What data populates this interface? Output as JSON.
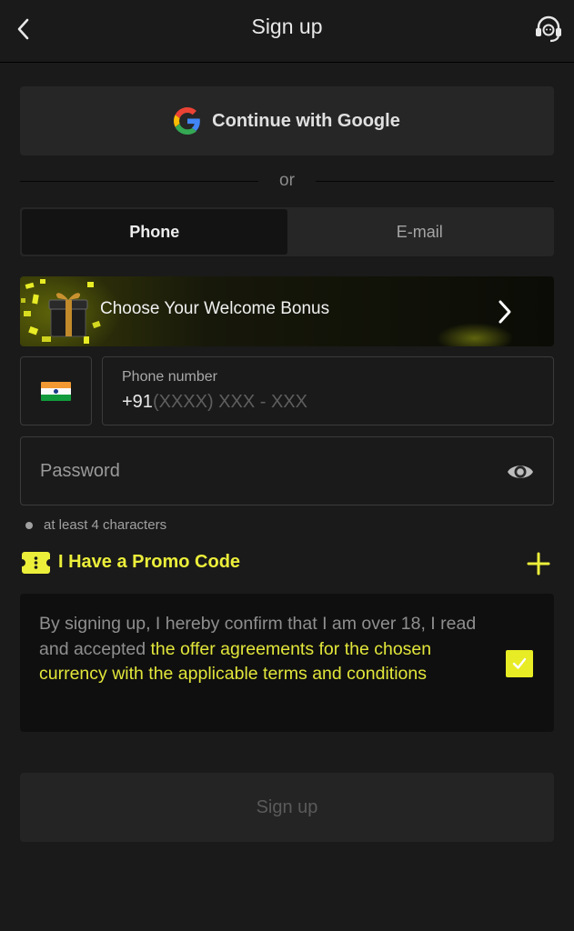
{
  "header": {
    "title": "Sign up"
  },
  "google": {
    "label": "Continue with Google"
  },
  "divider": {
    "text": "or"
  },
  "tabs": [
    {
      "label": "Phone",
      "active": true
    },
    {
      "label": "E-mail",
      "active": false
    }
  ],
  "bonus": {
    "label": "Choose Your Welcome Bonus"
  },
  "phone": {
    "label": "Phone number",
    "prefix": "+91",
    "placeholder": "(XXXX) XXX - XXX"
  },
  "password": {
    "placeholder": "Password"
  },
  "hint": {
    "text": "at least 4 characters"
  },
  "promo": {
    "label": "I Have a Promo Code"
  },
  "terms": {
    "text_plain": "By signing up, I hereby confirm that I am over 18, I read and accepted ",
    "text_link": "the offer agreements for the chosen currency with the applicable terms and conditions",
    "checked": true
  },
  "signup": {
    "label": "Sign up"
  },
  "colors": {
    "accent": "#e8ec25",
    "background": "#1a1a1a",
    "terms_bg": "#0f0f0f"
  }
}
